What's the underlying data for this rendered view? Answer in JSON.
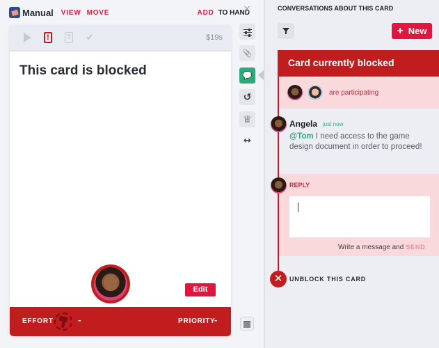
{
  "header": {
    "title": "Manual",
    "view_label": "VIEW",
    "move_label": "MOVE",
    "add_label": "ADD",
    "to_hand_label": "TO HAND",
    "close_glyph": "×"
  },
  "card": {
    "price": "$19s",
    "title": "This card is blocked",
    "edit_label": "Edit",
    "effort_label": "EFFORT",
    "effort_value": "-",
    "priority_label": "PRIORITY",
    "priority_value": "-",
    "status_icons": [
      "play-icon",
      "blocked-icon",
      "question-icon",
      "check-icon"
    ],
    "blocked_glyph": "!",
    "question_glyph": "?",
    "check_glyph": "✔"
  },
  "side_toolbar": {
    "items": [
      "settings-sliders-icon",
      "attachment-icon",
      "conversations-icon",
      "history-icon",
      "crown-icon",
      "expand-icon"
    ],
    "attachment_glyph": "📎",
    "chat_glyph": "💬",
    "history_glyph": "↺",
    "crown_glyph": "♕",
    "expand_glyph": "↔"
  },
  "conversations": {
    "header": "CONVERSATIONS ABOUT THIS CARD",
    "new_label": "New",
    "new_plus": "+",
    "thread": {
      "title": "Card currently blocked",
      "participants_text": "are participating",
      "participants": [
        "Angela",
        "Tom"
      ],
      "message": {
        "author": "Angela",
        "time": "just now",
        "mention": "@Tom",
        "text": " I need access to the game design document in order to proceed!"
      },
      "reply": {
        "label": "REPLY",
        "input_value": "",
        "hint": "Write a message and",
        "send_label": "SEND"
      },
      "unblock_label": "UNBLOCK THIS CARD",
      "unblock_glyph": "✕"
    }
  },
  "colors": {
    "accent_red": "#e0163e",
    "blocked_red": "#c11c1e",
    "green": "#2bab7c",
    "pink_bg": "#f9d9dc"
  }
}
